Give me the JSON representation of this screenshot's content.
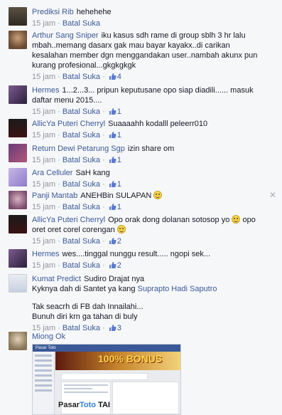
{
  "labels": {
    "time": "15 jam",
    "reply": "Batal Suka"
  },
  "comments": [
    {
      "author": "Prediksi Rib",
      "text": "hehehehe",
      "likes": null
    },
    {
      "author": "Arthur Sang Sniper",
      "text": "iku kasus sdh rame di group sblh 3 hr lalu mbah..memang dasarx gak mau bayar kayakx..di carikan kesalahan member dgn menggandakan user..nambah akunx pun kurang profesional...gkgkgkgk",
      "likes": "4"
    },
    {
      "author": "Hermes",
      "text": "1...2...3... pripun keputusane opo siap diadili...... masuk daftar menu 2015....",
      "likes": "1"
    },
    {
      "author": "AllicYa Puteri Cherryl",
      "text": "Suaaaahh kodalll peleerr010",
      "likes": "1"
    },
    {
      "author": "Return Dewi Petarung Sgp",
      "text": "izin share om",
      "likes": "1"
    },
    {
      "author": "Ara Celluler",
      "text": "SaH kang",
      "likes": "1"
    },
    {
      "author": "Panji Mantab",
      "text": "ANEHBin SULAPAN",
      "likes": "1"
    },
    {
      "author": "AllicYa Puteri Cherryl",
      "text": "Opo orak dong dolanan sotosop yo",
      "text2": "opo oret oret corel corengan",
      "likes": "2"
    },
    {
      "author": "Hermes",
      "text": "wes....tinggal nunggu result..... ngopi sek...",
      "likes": "2"
    },
    {
      "author": "Kumat Predict",
      "text": "Sudiro Drajat nya",
      "line2": "Kyknya dah di Santet ya kang",
      "mention": "Suprapto Hadi Saputro",
      "line3": "Tak seacrh di FB dah Innailahi...",
      "line4": "Bunuh diri krn ga tahan di buly",
      "likes": "3"
    },
    {
      "author": "Miong Ok"
    }
  ],
  "screenshot": {
    "title_bar": "Pasar Toto",
    "banner": "100% BONUS",
    "brand_a": "Pasar",
    "brand_b": "Toto",
    "brand_c": "TAI"
  },
  "colors": {
    "link": "#3b5998",
    "meta": "#90949c",
    "bg": "#f6f7f9"
  }
}
